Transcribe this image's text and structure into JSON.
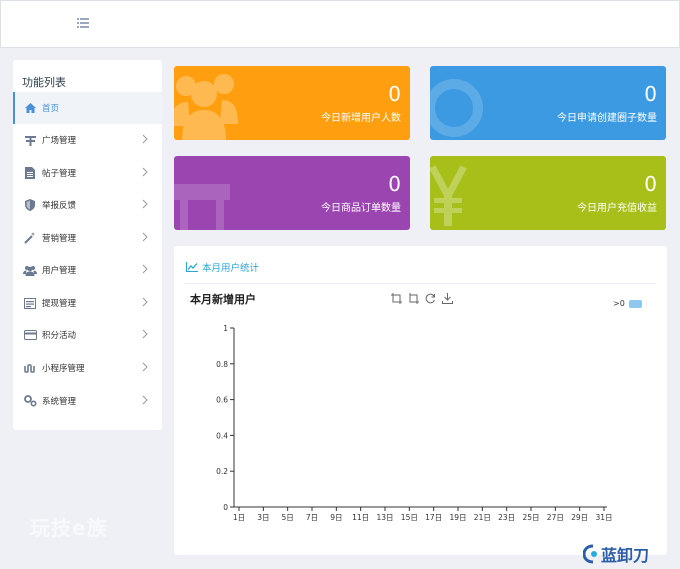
{
  "header": {
    "menu_icon": "list-icon"
  },
  "sidebar": {
    "title": "功能列表",
    "items": [
      {
        "label": "首页",
        "icon": "home-icon",
        "active": true
      },
      {
        "label": "广场管理",
        "icon": "plaza-icon",
        "active": false
      },
      {
        "label": "帖子管理",
        "icon": "file-icon",
        "active": false
      },
      {
        "label": "举报反馈",
        "icon": "shield-icon",
        "active": false
      },
      {
        "label": "营销管理",
        "icon": "magic-wand-icon",
        "active": false
      },
      {
        "label": "用户管理",
        "icon": "users-icon",
        "active": false
      },
      {
        "label": "提现管理",
        "icon": "withdraw-icon",
        "active": false
      },
      {
        "label": "积分活动",
        "icon": "credit-card-icon",
        "active": false
      },
      {
        "label": "小程序管理",
        "icon": "link-icon",
        "active": false
      },
      {
        "label": "系统管理",
        "icon": "gears-icon",
        "active": false
      }
    ]
  },
  "stats": [
    {
      "value": "0",
      "label": "今日新增用户人数",
      "color": "#ff9f0f",
      "icon": "users-icon"
    },
    {
      "value": "0",
      "label": "今日申请创建圈子数量",
      "color": "#3b9ae1",
      "icon": "circle-icon"
    },
    {
      "value": "0",
      "label": "今日商品订单数量",
      "color": "#9b45b0",
      "icon": "sofa-icon"
    },
    {
      "value": "0",
      "label": "今日用户充值收益",
      "color": "#a8bf1a",
      "icon": "yen-icon"
    }
  ],
  "panel": {
    "header": "本月用户统计",
    "header_icon": "line-chart-icon"
  },
  "chart_data": {
    "type": "line",
    "title": "本月新增用户",
    "legend": [
      ">0"
    ],
    "legend_position": "top-right",
    "x": [
      "1日",
      "3日",
      "5日",
      "7日",
      "9日",
      "11日",
      "13日",
      "15日",
      "17日",
      "19日",
      "21日",
      "23日",
      "25日",
      "27日",
      "29日",
      "31日"
    ],
    "series": [],
    "yticks": [
      "0",
      "0.2",
      "0.4",
      "0.6",
      "0.8",
      "1"
    ],
    "ylim": [
      0,
      1
    ],
    "grid": false,
    "toolbox": [
      "zoom-icon",
      "zoom-reset-icon",
      "refresh-icon",
      "download-icon"
    ]
  },
  "watermark": {
    "text": "玩技e族",
    "logo_text": "蓝卸刀"
  }
}
